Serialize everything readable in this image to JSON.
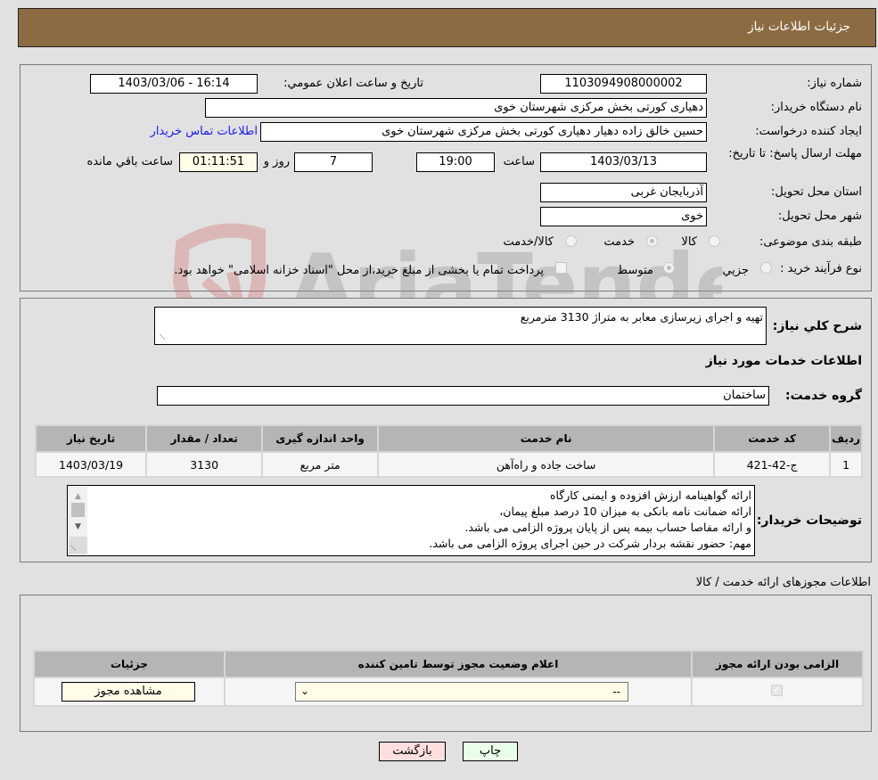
{
  "header": {
    "title": "جزئیات اطلاعات نیاز"
  },
  "details": {
    "need_number": {
      "label": "شماره نیاز:",
      "value": "1103094908000002"
    },
    "announce_datetime": {
      "label": "تاریخ و ساعت اعلان عمومي:",
      "value": "1403/03/06 - 16:14"
    },
    "buyer_org": {
      "label": "نام دستگاه خریدار:",
      "value": "دهیاری کورتی بخش مرکزی شهرستان خوی"
    },
    "requester": {
      "label": "ایجاد کننده درخواست:",
      "value": "حسین خالق زاده دهیار دهیاری کورتی بخش مرکزی شهرستان خوی"
    },
    "buyer_contact_link": "اطلاعات تماس خریدار",
    "deadline": {
      "label": "مهلت ارسال پاسخ: تا تاریخ:",
      "date": "1403/03/13",
      "time_label": "ساعت",
      "time": "19:00",
      "days": "7",
      "days_label": "روز و",
      "remaining": "01:11:51",
      "remaining_label": "ساعت باقي مانده"
    },
    "delivery_province": {
      "label": "استان محل تحویل:",
      "value": "آذربایجان غربی"
    },
    "delivery_city": {
      "label": "شهر محل تحویل:",
      "value": "خوی"
    },
    "category": {
      "label": "طبقه بندی موضوعی:",
      "options": [
        "کالا",
        "خدمت",
        "کالا/خدمت"
      ],
      "selected": "خدمت"
    },
    "purchase_type": {
      "label": "نوع فرآیند خرید :",
      "options": [
        "جزيي",
        "متوسط"
      ],
      "selected": "متوسط",
      "treasury_note": "پرداخت تمام یا بخشی از مبلغ خرید،از محل \"اسناد خزانه اسلامی\" خواهد بود."
    }
  },
  "description": {
    "label": "شرح کلي نیاز:",
    "value": "تهیه و اجرای زیرسازی معابر به متراژ 3130 مترمربع"
  },
  "services": {
    "section_title": "اطلاعات خدمات مورد نیاز",
    "group_label": "گروه خدمت:",
    "group_value": "ساختمان",
    "table": {
      "headers": [
        "ردیف",
        "کد خدمت",
        "نام خدمت",
        "واحد اندازه گیری",
        "تعداد / مقدار",
        "تاریخ نیاز"
      ],
      "rows": [
        [
          "1",
          "ج-42-421",
          "ساخت جاده و راه‌آهن",
          "متر مربع",
          "3130",
          "1403/03/19"
        ]
      ]
    }
  },
  "buyer_notes": {
    "label": "توضیحات خریدار:",
    "lines": [
      "ارائه گواهینامه ارزش افزوده و ایمنی کارگاه",
      "ارائه ضمانت نامه بانکی به میزان 10 درصد مبلغ پیمان،",
      "و ارائه مفاصا حساب بیمه پس از پایان پروژه الزامی می باشد.",
      "مهم: حضور نقشه بردار شرکت در حین اجرای پروژه الزامی می باشد."
    ]
  },
  "permits": {
    "section_title": "اطلاعات مجوزهای ارائه خدمت / کالا",
    "headers": [
      "الزامی بودن ارائه مجوز",
      "اعلام وضعیت مجوز توسط تامین کننده",
      "جزئیات"
    ],
    "row": {
      "required": true,
      "status_value": "--",
      "view_button": "مشاهده مجوز"
    }
  },
  "footer": {
    "print_button": "چاپ",
    "back_button": "بازگشت"
  },
  "watermark": {
    "text": "AriaTender.neT"
  },
  "colors": {
    "header_bg": "#8c6b42",
    "link": "#1a1aee",
    "back_btn": "#ffdede",
    "print_btn": "#eaffe8"
  }
}
